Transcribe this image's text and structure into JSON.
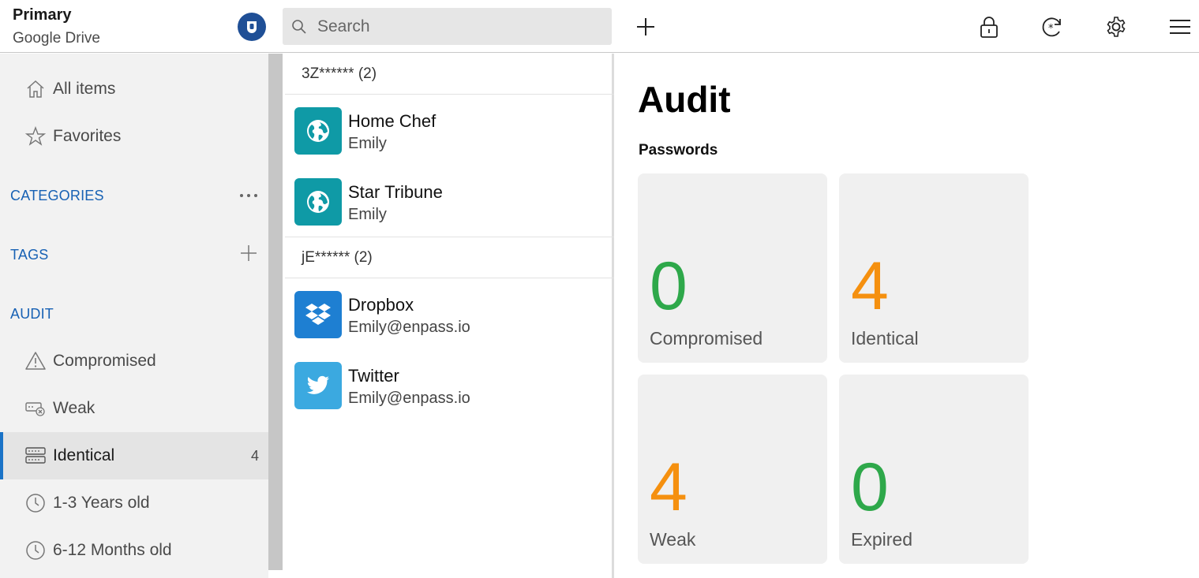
{
  "header": {
    "vault_title": "Primary",
    "vault_subtitle": "Google Drive",
    "search_placeholder": "Search",
    "icons": [
      "enpass-logo-icon",
      "search-icon",
      "plus-icon",
      "lock-icon",
      "sync-icon",
      "gear-icon",
      "menu-icon"
    ]
  },
  "sidebar": {
    "all_items": "All items",
    "favorites": "Favorites",
    "categories_heading": "CATEGORIES",
    "tags_heading": "TAGS",
    "audit_heading": "AUDIT",
    "audit_items": [
      {
        "label": "Compromised",
        "icon": "warning-icon",
        "count": ""
      },
      {
        "label": "Weak",
        "icon": "weak-password-icon",
        "count": ""
      },
      {
        "label": "Identical",
        "icon": "identical-icon",
        "count": "4",
        "active": true
      },
      {
        "label": "1-3 Years old",
        "icon": "clock-icon",
        "count": ""
      },
      {
        "label": "6-12 Months old",
        "icon": "clock-icon",
        "count": ""
      }
    ]
  },
  "list": {
    "groups": [
      {
        "header": "3Z****** (2)",
        "items": [
          {
            "title": "Home Chef",
            "subtitle": "Emily",
            "icon": "globe-icon",
            "color": "#0f9aa6"
          },
          {
            "title": "Star Tribune",
            "subtitle": "Emily",
            "icon": "globe-icon",
            "color": "#0f9aa6"
          }
        ]
      },
      {
        "header": "jE****** (2)",
        "items": [
          {
            "title": "Dropbox",
            "subtitle": "Emily@enpass.io",
            "icon": "dropbox-icon",
            "color": "#1e7fd2"
          },
          {
            "title": "Twitter",
            "subtitle": "Emily@enpass.io",
            "icon": "twitter-icon",
            "color": "#3ba9e0"
          }
        ]
      }
    ]
  },
  "audit": {
    "title": "Audit",
    "section": "Passwords",
    "cards": [
      {
        "value": "0",
        "label": "Compromised",
        "color": "#2ea84a"
      },
      {
        "value": "4",
        "label": "Identical",
        "color": "#f5900f"
      },
      {
        "value": "4",
        "label": "Weak",
        "color": "#f5900f"
      },
      {
        "value": "0",
        "label": "Expired",
        "color": "#2ea84a"
      }
    ]
  },
  "colors": {
    "accent": "#1761b4",
    "active_bar": "#1a73c7",
    "good": "#2ea84a",
    "warn": "#f5900f"
  }
}
